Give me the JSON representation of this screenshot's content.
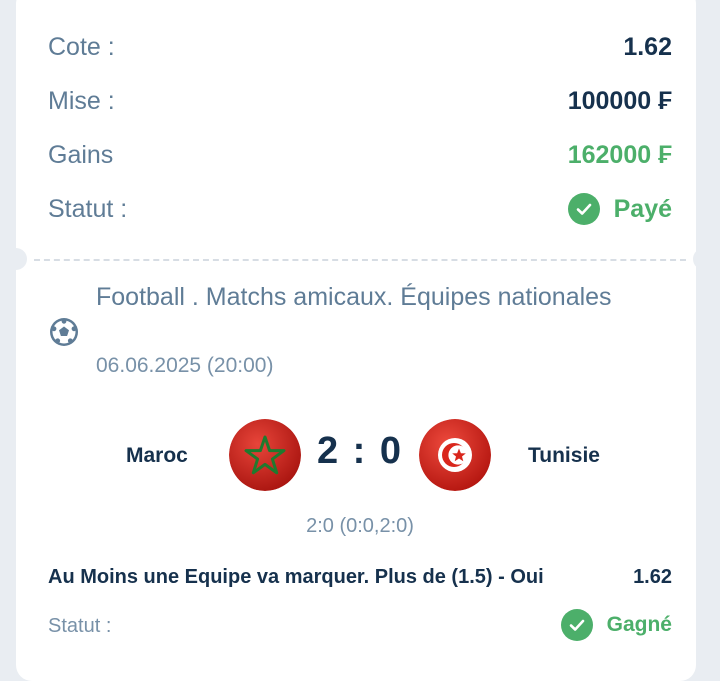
{
  "summary": {
    "odds_label": "Cote :",
    "odds_value": "1.62",
    "stake_label": "Mise :",
    "stake_value": "100000 ₣",
    "winnings_label": "Gains",
    "winnings_value": "162000 ₣",
    "status_label": "Statut :",
    "status_value": "Payé"
  },
  "event": {
    "sport_icon": "soccer-ball-icon",
    "title": "Football . Matchs amicaux. Équipes nationales",
    "datetime": "06.06.2025 (20:00)",
    "home_team": "Maroc",
    "away_team": "Tunisie",
    "score": "2 : 0",
    "score_detail": "2:0 (0:0,2:0)",
    "selection": "Au Moins une Equipe va marquer. Plus de (1.5) - Oui",
    "selection_odds": "1.62",
    "status_label": "Statut :",
    "status_value": "Gagné"
  },
  "colors": {
    "accent_green": "#4caf6a",
    "text_dark": "#16314d",
    "text_muted": "#5f7c96"
  }
}
